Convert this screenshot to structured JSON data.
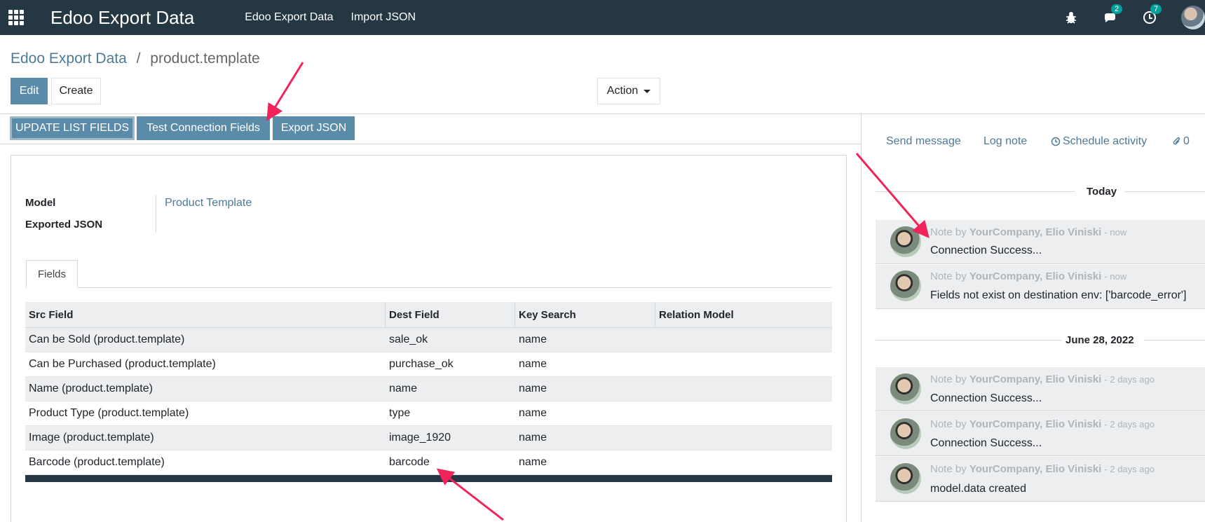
{
  "navbar": {
    "brand": "Edoo Export Data",
    "menu": [
      "Edoo Export Data",
      "Import JSON"
    ],
    "messages_count": "2",
    "activities_count": "7"
  },
  "breadcrumb": {
    "parent": "Edoo Export Data",
    "separator": "/",
    "current": "product.template"
  },
  "control": {
    "edit_label": "Edit",
    "create_label": "Create",
    "action_label": "Action"
  },
  "header_buttons": {
    "update": "UPDATE LIST FIELDS",
    "test": "Test Connection Fields",
    "export": "Export JSON"
  },
  "form": {
    "model_label": "Model",
    "model_value": "Product Template",
    "exported_label": "Exported JSON",
    "tab_label": "Fields"
  },
  "table": {
    "headers": [
      "Src Field",
      "Dest Field",
      "Key Search",
      "Relation Model"
    ],
    "rows": [
      [
        "Can be Sold (product.template)",
        "sale_ok",
        "name",
        ""
      ],
      [
        "Can be Purchased (product.template)",
        "purchase_ok",
        "name",
        ""
      ],
      [
        "Name (product.template)",
        "name",
        "name",
        ""
      ],
      [
        "Product Type (product.template)",
        "type",
        "name",
        ""
      ],
      [
        "Image (product.template)",
        "image_1920",
        "name",
        ""
      ],
      [
        "Barcode (product.template)",
        "barcode",
        "name",
        ""
      ]
    ]
  },
  "chatter": {
    "send_message": "Send message",
    "log_note": "Log note",
    "schedule_activity": "Schedule activity",
    "attachments": "0",
    "today_label": "Today",
    "date_label": "June 28, 2022",
    "note_by": "Note by",
    "author": "YourCompany, Elio Viniski",
    "messages": [
      {
        "time": "- now",
        "body": "Connection Success..."
      },
      {
        "time": "- now",
        "body": "Fields not exist on destination env: ['barcode_error']"
      },
      {
        "time": "- 2 days ago",
        "body": "Connection Success..."
      },
      {
        "time": "- 2 days ago",
        "body": "Connection Success..."
      },
      {
        "time": "- 2 days ago",
        "body": "model.data created"
      }
    ]
  },
  "colors": {
    "navbar": "#243742",
    "primary": "#5a8ba8",
    "link": "#4c7a97",
    "arrow": "#f0245a"
  }
}
